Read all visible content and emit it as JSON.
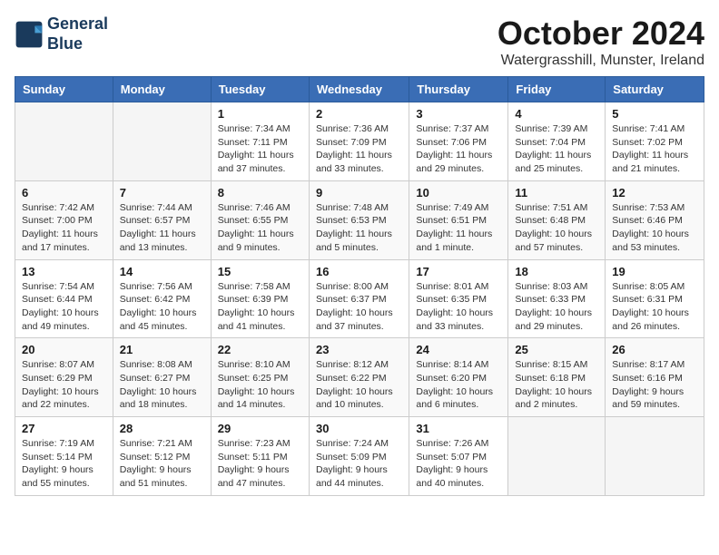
{
  "header": {
    "logo_line1": "General",
    "logo_line2": "Blue",
    "month_title": "October 2024",
    "location": "Watergrasshill, Munster, Ireland"
  },
  "weekdays": [
    "Sunday",
    "Monday",
    "Tuesday",
    "Wednesday",
    "Thursday",
    "Friday",
    "Saturday"
  ],
  "weeks": [
    [
      {
        "day": "",
        "info": ""
      },
      {
        "day": "",
        "info": ""
      },
      {
        "day": "1",
        "info": "Sunrise: 7:34 AM\nSunset: 7:11 PM\nDaylight: 11 hours and 37 minutes."
      },
      {
        "day": "2",
        "info": "Sunrise: 7:36 AM\nSunset: 7:09 PM\nDaylight: 11 hours and 33 minutes."
      },
      {
        "day": "3",
        "info": "Sunrise: 7:37 AM\nSunset: 7:06 PM\nDaylight: 11 hours and 29 minutes."
      },
      {
        "day": "4",
        "info": "Sunrise: 7:39 AM\nSunset: 7:04 PM\nDaylight: 11 hours and 25 minutes."
      },
      {
        "day": "5",
        "info": "Sunrise: 7:41 AM\nSunset: 7:02 PM\nDaylight: 11 hours and 21 minutes."
      }
    ],
    [
      {
        "day": "6",
        "info": "Sunrise: 7:42 AM\nSunset: 7:00 PM\nDaylight: 11 hours and 17 minutes."
      },
      {
        "day": "7",
        "info": "Sunrise: 7:44 AM\nSunset: 6:57 PM\nDaylight: 11 hours and 13 minutes."
      },
      {
        "day": "8",
        "info": "Sunrise: 7:46 AM\nSunset: 6:55 PM\nDaylight: 11 hours and 9 minutes."
      },
      {
        "day": "9",
        "info": "Sunrise: 7:48 AM\nSunset: 6:53 PM\nDaylight: 11 hours and 5 minutes."
      },
      {
        "day": "10",
        "info": "Sunrise: 7:49 AM\nSunset: 6:51 PM\nDaylight: 11 hours and 1 minute."
      },
      {
        "day": "11",
        "info": "Sunrise: 7:51 AM\nSunset: 6:48 PM\nDaylight: 10 hours and 57 minutes."
      },
      {
        "day": "12",
        "info": "Sunrise: 7:53 AM\nSunset: 6:46 PM\nDaylight: 10 hours and 53 minutes."
      }
    ],
    [
      {
        "day": "13",
        "info": "Sunrise: 7:54 AM\nSunset: 6:44 PM\nDaylight: 10 hours and 49 minutes."
      },
      {
        "day": "14",
        "info": "Sunrise: 7:56 AM\nSunset: 6:42 PM\nDaylight: 10 hours and 45 minutes."
      },
      {
        "day": "15",
        "info": "Sunrise: 7:58 AM\nSunset: 6:39 PM\nDaylight: 10 hours and 41 minutes."
      },
      {
        "day": "16",
        "info": "Sunrise: 8:00 AM\nSunset: 6:37 PM\nDaylight: 10 hours and 37 minutes."
      },
      {
        "day": "17",
        "info": "Sunrise: 8:01 AM\nSunset: 6:35 PM\nDaylight: 10 hours and 33 minutes."
      },
      {
        "day": "18",
        "info": "Sunrise: 8:03 AM\nSunset: 6:33 PM\nDaylight: 10 hours and 29 minutes."
      },
      {
        "day": "19",
        "info": "Sunrise: 8:05 AM\nSunset: 6:31 PM\nDaylight: 10 hours and 26 minutes."
      }
    ],
    [
      {
        "day": "20",
        "info": "Sunrise: 8:07 AM\nSunset: 6:29 PM\nDaylight: 10 hours and 22 minutes."
      },
      {
        "day": "21",
        "info": "Sunrise: 8:08 AM\nSunset: 6:27 PM\nDaylight: 10 hours and 18 minutes."
      },
      {
        "day": "22",
        "info": "Sunrise: 8:10 AM\nSunset: 6:25 PM\nDaylight: 10 hours and 14 minutes."
      },
      {
        "day": "23",
        "info": "Sunrise: 8:12 AM\nSunset: 6:22 PM\nDaylight: 10 hours and 10 minutes."
      },
      {
        "day": "24",
        "info": "Sunrise: 8:14 AM\nSunset: 6:20 PM\nDaylight: 10 hours and 6 minutes."
      },
      {
        "day": "25",
        "info": "Sunrise: 8:15 AM\nSunset: 6:18 PM\nDaylight: 10 hours and 2 minutes."
      },
      {
        "day": "26",
        "info": "Sunrise: 8:17 AM\nSunset: 6:16 PM\nDaylight: 9 hours and 59 minutes."
      }
    ],
    [
      {
        "day": "27",
        "info": "Sunrise: 7:19 AM\nSunset: 5:14 PM\nDaylight: 9 hours and 55 minutes."
      },
      {
        "day": "28",
        "info": "Sunrise: 7:21 AM\nSunset: 5:12 PM\nDaylight: 9 hours and 51 minutes."
      },
      {
        "day": "29",
        "info": "Sunrise: 7:23 AM\nSunset: 5:11 PM\nDaylight: 9 hours and 47 minutes."
      },
      {
        "day": "30",
        "info": "Sunrise: 7:24 AM\nSunset: 5:09 PM\nDaylight: 9 hours and 44 minutes."
      },
      {
        "day": "31",
        "info": "Sunrise: 7:26 AM\nSunset: 5:07 PM\nDaylight: 9 hours and 40 minutes."
      },
      {
        "day": "",
        "info": ""
      },
      {
        "day": "",
        "info": ""
      }
    ]
  ]
}
